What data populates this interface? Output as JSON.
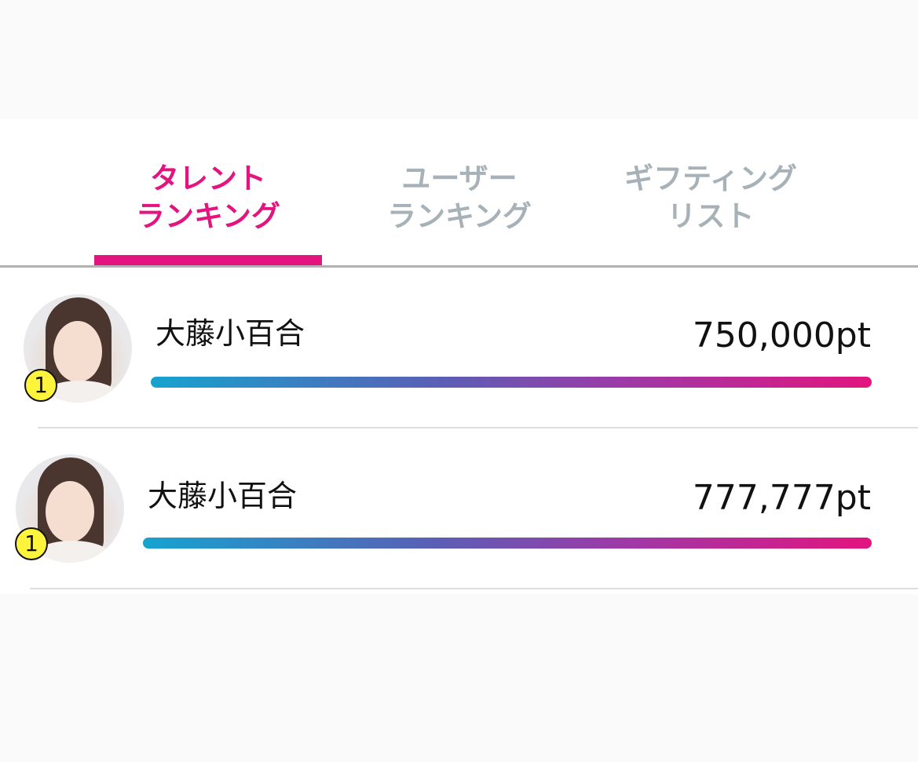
{
  "tabs": [
    {
      "line1": "タレント",
      "line2": "ランキング",
      "active": true
    },
    {
      "line1": "ユーザー",
      "line2": "ランキング",
      "active": false
    },
    {
      "line1": "ギフティング",
      "line2": "リスト",
      "active": false
    }
  ],
  "ranking": [
    {
      "rank": "1",
      "name": "大藤小百合",
      "points": "750,000pt",
      "progress": 1.0
    },
    {
      "rank": "1",
      "name": "大藤小百合",
      "points": "777,777pt",
      "progress": 1.0
    }
  ],
  "colors": {
    "accent": "#e3147f",
    "tab_inactive": "#a7b1b8",
    "bar_start": "#16a3cf",
    "bar_end": "#e3147f",
    "badge": "#fff43c"
  }
}
